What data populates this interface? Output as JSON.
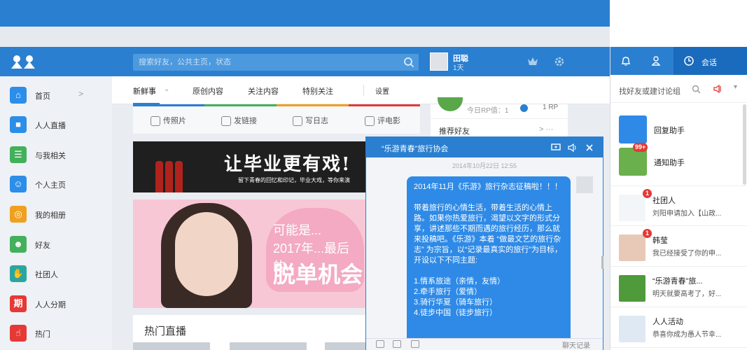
{
  "header": {
    "search_placeholder": "搜索好友，公共主页，状态",
    "user_name": "田聪",
    "user_days": "1天"
  },
  "sidebar": {
    "items": [
      {
        "label": "首页",
        "icon": "home-icon",
        "color": "#2c8ee8"
      },
      {
        "label": "人人直播",
        "icon": "video-icon",
        "color": "#2c8ee8"
      },
      {
        "label": "与我相关",
        "icon": "people-list-icon",
        "color": "#43b05c"
      },
      {
        "label": "个人主页",
        "icon": "person-icon",
        "color": "#2c8ee8"
      },
      {
        "label": "我的相册",
        "icon": "album-icon",
        "color": "#f0a020"
      },
      {
        "label": "好友",
        "icon": "friends-icon",
        "color": "#43b05c"
      },
      {
        "label": "社团人",
        "icon": "club-icon",
        "color": "#2aa6a0"
      },
      {
        "label": "人人分期",
        "icon": "installment-icon",
        "color": "#e53935"
      },
      {
        "label": "热门",
        "icon": "hot-icon",
        "color": "#e53935"
      }
    ],
    "installment_glyph": "期"
  },
  "tabs": {
    "items": [
      "新鲜事",
      "原创内容",
      "关注内容",
      "特别关注",
      "设置"
    ]
  },
  "compose": {
    "items": [
      "传照片",
      "发链接",
      "写日志",
      "评电影"
    ]
  },
  "banner1": {
    "text": "让毕业更有戏!",
    "sub": "留下青春的回忆和印记，毕业大戏，等你来演"
  },
  "banner2": {
    "line1": "可能是...",
    "line2": "2017年...最后的..",
    "line3": "脱单机会"
  },
  "hot_live": {
    "title": "热门直播"
  },
  "rp_panel": {
    "rp_label": "今日RP值：1",
    "rp_unit": "1 RP",
    "recommend": "推荐好友",
    "more": "> ···"
  },
  "chat": {
    "title": "“乐游青春”旅行协会",
    "time": "2014年10月22日 12:55",
    "paragraphs": [
      "2014年11月《乐游》旅行杂志征稿啦！！！",
      "带着旅行的心情生活，带着生活的心情上路。如果你热爱旅行，渴望以文字的形式分享，讲述那些不期而遇的旅行经历，那么就来投稿吧。《乐游》本着 “做最文艺的旅行杂志” 为宗旨，以“记录最真实的旅行”为目标，开设以下不同主题:",
      "1.情系旅途（亲情，友情）\n2.牵手旅行（爱情）\n3.骑行华夏（骑车旅行）\n4.徒步中国（徒步旅行）"
    ],
    "history": "聊天记录"
  },
  "right_panel": {
    "active_tab": "会话",
    "search_placeholder": "找好友或建讨论组",
    "helpers": [
      {
        "name": "回复助手",
        "color": "#2e8ae6",
        "badge": ""
      },
      {
        "name": "通知助手",
        "color": "#6ab04c",
        "badge": "99+"
      }
    ],
    "contacts": [
      {
        "name": "社团人",
        "msg": "刘阳申请加入【山政...",
        "badge": "1",
        "color": "#f2f6f8"
      },
      {
        "name": "韩莹",
        "msg": "我已经接受了你的申...",
        "badge": "1",
        "color": "#e8c9b8"
      },
      {
        "name": "“乐游青春”旅...",
        "msg": "明天就要高考了，好...",
        "badge": "",
        "color": "#4f9a3a"
      },
      {
        "name": "人人活动",
        "msg": "恭喜你成为愚人节幸...",
        "badge": "",
        "color": "#dfe9f3"
      }
    ]
  }
}
